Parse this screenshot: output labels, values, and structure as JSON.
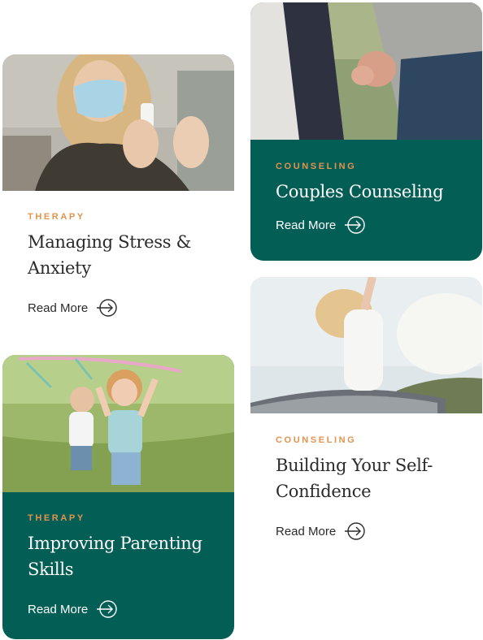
{
  "cards": [
    {
      "category": "THERAPY",
      "title": "Managing Stress & Anxiety",
      "link": "Read More",
      "image": "woman-mask-sanitizer-photo"
    },
    {
      "category": "COUNSELING",
      "title": "Couples Counseling",
      "link": "Read More",
      "image": "couple-holding-hands-photo"
    },
    {
      "category": "THERAPY",
      "title": "Improving Parenting Skills",
      "link": "Read More",
      "image": "children-playing-kite-photo"
    },
    {
      "category": "COUNSELING",
      "title": "Building Your Self-Confidence",
      "link": "Read More",
      "image": "woman-car-sunroof-photo"
    }
  ],
  "colors": {
    "dark_card": "#035e56",
    "category_accent": "#e3934d",
    "text_dark": "#2b2b2b",
    "text_light": "#ffffff"
  }
}
